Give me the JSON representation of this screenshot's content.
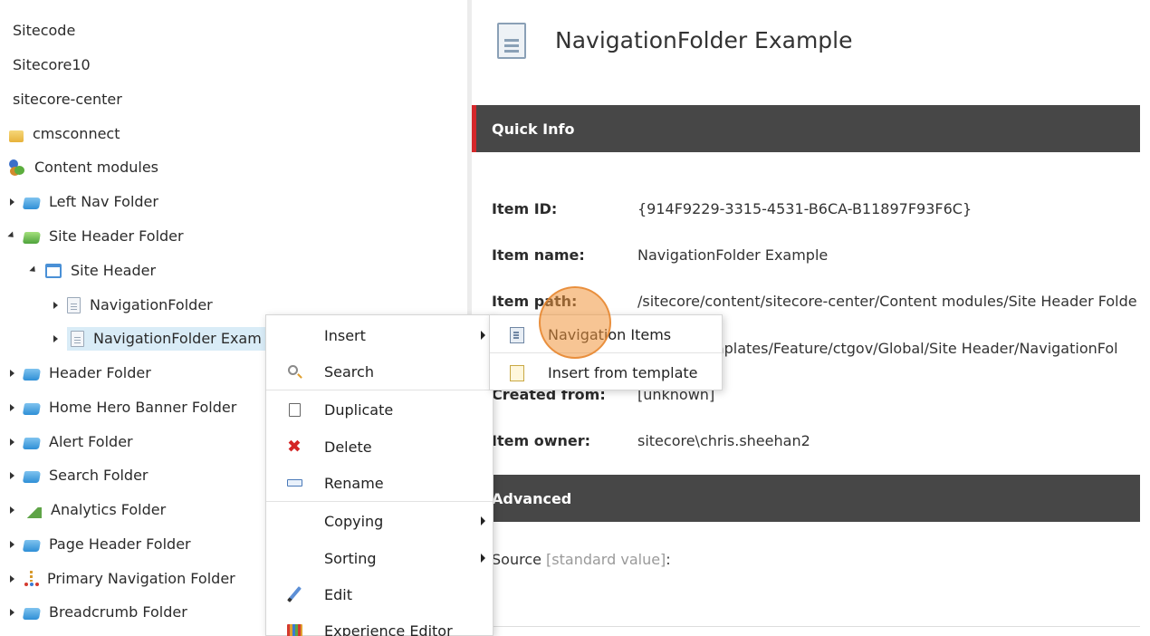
{
  "tree": {
    "items": [
      {
        "label": "Sitecode",
        "icon": "none",
        "expander": "none"
      },
      {
        "label": "Sitecore10",
        "icon": "none",
        "expander": "none"
      },
      {
        "label": "sitecore-center",
        "icon": "none",
        "expander": "none"
      },
      {
        "label": "cmsconnect",
        "icon": "folder-yellow-icon",
        "expander": "none"
      },
      {
        "label": "Content modules",
        "icon": "content-modules-icon",
        "expander": "none"
      },
      {
        "label": "Left Nav Folder",
        "icon": "folder-blue-icon",
        "expander": "collapsed"
      },
      {
        "label": "Site Header Folder",
        "icon": "folder-green-icon",
        "expander": "expanded"
      },
      {
        "label": "Site Header",
        "icon": "window-icon",
        "expander": "expanded"
      },
      {
        "label": "NavigationFolder",
        "icon": "page-icon",
        "expander": "collapsed"
      },
      {
        "label": "NavigationFolder Exam",
        "icon": "page-icon",
        "expander": "collapsed",
        "selected": true
      },
      {
        "label": "Header Folder",
        "icon": "folder-blue-icon",
        "expander": "collapsed"
      },
      {
        "label": "Home Hero Banner Folder",
        "icon": "folder-blue-icon",
        "expander": "collapsed"
      },
      {
        "label": "Alert Folder",
        "icon": "folder-blue-icon",
        "expander": "collapsed"
      },
      {
        "label": "Search Folder",
        "icon": "folder-blue-icon",
        "expander": "collapsed"
      },
      {
        "label": "Analytics Folder",
        "icon": "analytics-icon",
        "expander": "collapsed"
      },
      {
        "label": "Page Header Folder",
        "icon": "folder-blue-icon",
        "expander": "collapsed"
      },
      {
        "label": "Primary Navigation Folder",
        "icon": "navigation-icon",
        "expander": "collapsed"
      },
      {
        "label": "Breadcrumb Folder",
        "icon": "folder-blue-icon",
        "expander": "collapsed"
      }
    ]
  },
  "item": {
    "title": "NavigationFolder Example"
  },
  "quick_info": {
    "header": "Quick Info",
    "item_id_label": "Item ID:",
    "item_id": "{914F9229-3315-4531-B6CA-B11897F93F6C}",
    "item_name_label": "Item name:",
    "item_name": "NavigationFolder Example",
    "item_path_label": "Item path:",
    "item_path": "/sitecore/content/sitecore-center/Content modules/Site Header Folde",
    "template_value": "mplates/Feature/ctgov/Global/Site Header/NavigationFol",
    "created_from_label": "Created from:",
    "created_from": "[unknown]",
    "item_owner_label": "Item owner:",
    "item_owner": "sitecore\\chris.sheehan2"
  },
  "advanced": {
    "header": "Advanced",
    "source_label": "Source",
    "source_hint": "[standard value]",
    "source_colon": ":"
  },
  "context_menu": {
    "items": [
      {
        "label": "Insert",
        "icon": "none",
        "submenu": true
      },
      {
        "label": "Search",
        "icon": "search-icon",
        "submenu": false
      },
      {
        "label": "Duplicate",
        "icon": "duplicate-icon",
        "submenu": false
      },
      {
        "label": "Delete",
        "icon": "delete-icon",
        "submenu": false
      },
      {
        "label": "Rename",
        "icon": "rename-icon",
        "submenu": false
      },
      {
        "label": "Copying",
        "icon": "none",
        "submenu": true
      },
      {
        "label": "Sorting",
        "icon": "none",
        "submenu": true
      },
      {
        "label": "Edit",
        "icon": "edit-icon",
        "submenu": false
      },
      {
        "label": "Experience Editor",
        "icon": "experience-editor-icon",
        "submenu": false
      }
    ]
  },
  "submenu": {
    "items": [
      {
        "label": "Navigation Items",
        "icon": "navigation-items-icon"
      },
      {
        "label": "Insert from template",
        "icon": "template-icon"
      }
    ]
  },
  "colors": {
    "section_bar": "#474747",
    "accent_red": "#d4282b",
    "selection": "#d9ecf7",
    "click_highlight": "#f0963c"
  }
}
